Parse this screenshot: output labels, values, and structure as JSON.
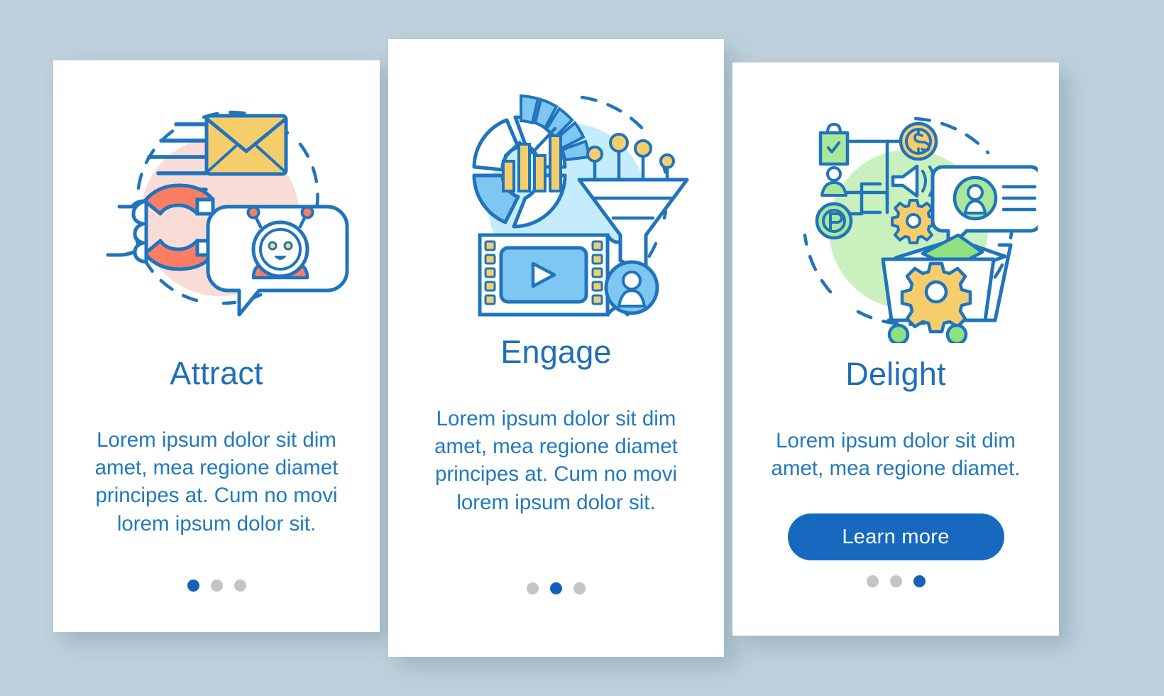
{
  "page": {
    "background_color": "#bdd0db",
    "accent_color": "#1769c0",
    "title_color": "#1f6fb8",
    "body_color": "#2179bd",
    "dot_active_color": "#1561ba",
    "dot_inactive_color": "#c2c5c8"
  },
  "cards": [
    {
      "id": "attract",
      "title": "Attract",
      "body": "Lorem ipsum dolor sit dim amet, mea regione diamet principes at. Cum no movi lorem ipsum dolor sit.",
      "illustration": {
        "name": "attract-magnet-email-chatbot-illustration",
        "blob_color": "#fadcd7",
        "accents": [
          "#f9c0b1",
          "#fb7d63",
          "#f6cd6b",
          "#1f74bd"
        ]
      },
      "dots": {
        "count": 3,
        "active_index": 0
      },
      "button": null
    },
    {
      "id": "engage",
      "title": "Engage",
      "body": "Lorem ipsum dolor sit dim amet, mea regione diamet principes at. Cum no movi lorem ipsum dolor sit.",
      "illustration": {
        "name": "engage-analytics-funnel-video-illustration",
        "blob_color": "#c5ecfa",
        "accents": [
          "#7ec7f2",
          "#4aa9e8",
          "#f6cd6b",
          "#1f74bd"
        ]
      },
      "dots": {
        "count": 3,
        "active_index": 1
      },
      "button": null
    },
    {
      "id": "delight",
      "title": "Delight",
      "body": "Lorem ipsum dolor sit dim amet, mea regione diamet.",
      "illustration": {
        "name": "delight-cart-feedback-rewards-illustration",
        "blob_color": "#c9f0bd",
        "accents": [
          "#8fe07f",
          "#b6ecab",
          "#f6cd6b",
          "#1f74bd"
        ]
      },
      "dots": {
        "count": 3,
        "active_index": 2
      },
      "button": {
        "label": "Learn more"
      }
    }
  ]
}
